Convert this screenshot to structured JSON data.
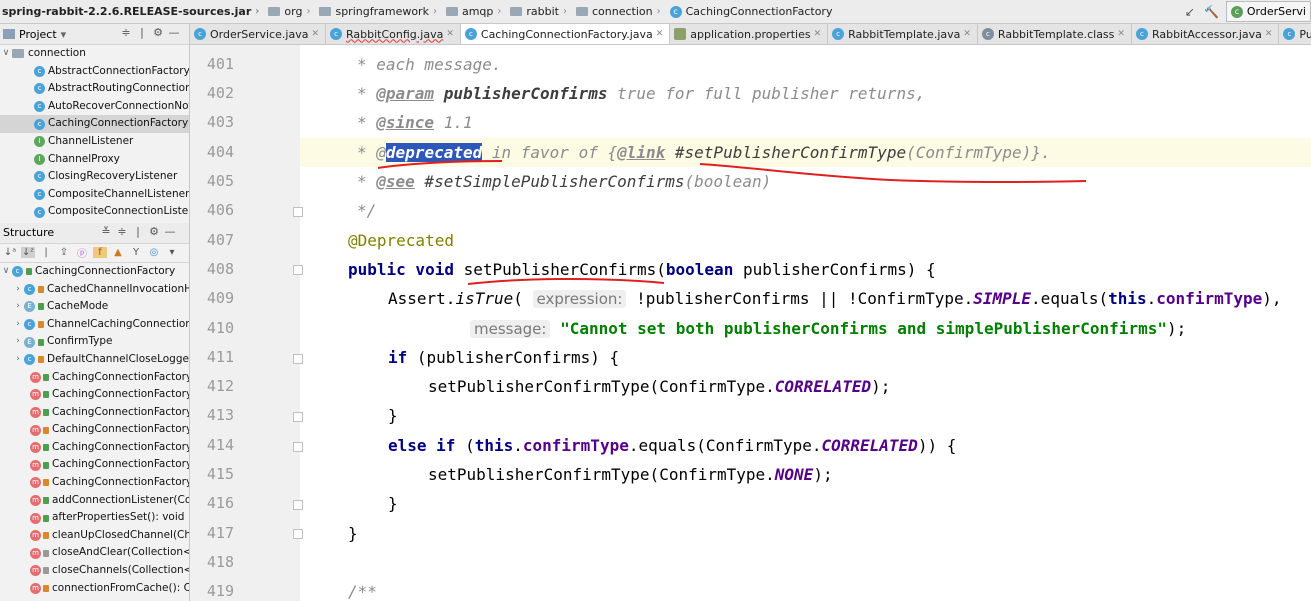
{
  "breadcrumb": {
    "items": [
      {
        "label": "spring-rabbit-2.2.6.RELEASE-sources.jar",
        "icon": "jar-icon"
      },
      {
        "label": "org",
        "icon": "folder-icon"
      },
      {
        "label": "springframework",
        "icon": "folder-icon"
      },
      {
        "label": "amqp",
        "icon": "folder-icon"
      },
      {
        "label": "rabbit",
        "icon": "folder-icon"
      },
      {
        "label": "connection",
        "icon": "folder-icon"
      },
      {
        "label": "CachingConnectionFactory",
        "icon": "class-icon"
      }
    ],
    "run_config": "OrderServi"
  },
  "project_panel": {
    "title": "Project",
    "folder": "connection",
    "items": [
      "AbstractConnectionFactory",
      "AbstractRoutingConnectionFa",
      "AutoRecoverConnectionNotC",
      "CachingConnectionFactory",
      "ChannelListener",
      "ChannelProxy",
      "ClosingRecoveryListener",
      "CompositeChannelListener",
      "CompositeConnectionListene"
    ],
    "selected_index": 3
  },
  "structure_panel": {
    "title": "Structure",
    "root": "CachingConnectionFactory",
    "nested": [
      {
        "label": "CachedChannelInvocationH",
        "kind": "class"
      },
      {
        "label": "CacheMode",
        "kind": "enum"
      },
      {
        "label": "ChannelCachingConnection",
        "kind": "class"
      },
      {
        "label": "ConfirmType",
        "kind": "enum"
      },
      {
        "label": "DefaultChannelCloseLogge",
        "kind": "class"
      }
    ],
    "members": [
      "CachingConnectionFactory(",
      "CachingConnectionFactory(",
      "CachingConnectionFactory(",
      "CachingConnectionFactory(",
      "CachingConnectionFactory(",
      "CachingConnectionFactory(",
      "CachingConnectionFactory(",
      "addConnectionListener(Co",
      "afterPropertiesSet(): void",
      "cleanUpClosedChannel(Cha",
      "closeAndClear(Collection<C",
      "closeChannels(Collection<C",
      "connectionFromCache(): Co"
    ]
  },
  "tabs": [
    {
      "label": "OrderService.java",
      "icon": "class",
      "active": false,
      "wavy": false
    },
    {
      "label": "RabbitConfig.java",
      "icon": "class",
      "active": false,
      "wavy": true
    },
    {
      "label": "CachingConnectionFactory.java",
      "icon": "class",
      "active": true,
      "wavy": false
    },
    {
      "label": "application.properties",
      "icon": "prop",
      "active": false,
      "wavy": false
    },
    {
      "label": "RabbitTemplate.java",
      "icon": "class",
      "active": false,
      "wavy": false
    },
    {
      "label": "RabbitTemplate.class",
      "icon": "cf",
      "active": false,
      "wavy": false
    },
    {
      "label": "RabbitAccessor.java",
      "icon": "class",
      "active": false,
      "wavy": false
    },
    {
      "label": "PublisherCallbackC",
      "icon": "class",
      "active": false,
      "wavy": false
    }
  ],
  "editor": {
    "line_numbers": [
      "401",
      "402",
      "403",
      "404",
      "405",
      "406",
      "407",
      "408",
      "409",
      "410",
      "411",
      "412",
      "413",
      "414",
      "415",
      "416",
      "417",
      "418",
      "419"
    ],
    "code": {
      "l401": "* each message.",
      "l402_star": "* ",
      "l402_tag": "@param",
      "l402_name": " publisherConfirms",
      "l402_rest": " true for full publisher returns,",
      "l403_star": "* ",
      "l403_tag": "@since",
      "l403_rest": " 1.1",
      "l404_star": "* @",
      "l404_sel": "deprecated",
      "l404_mid": " in favor of {",
      "l404_link": "@link",
      "l404_ref": " #setPublisherConfirmType",
      "l404_args": "(ConfirmType)",
      "l404_end": "}.",
      "l405_star": "* ",
      "l405_tag": "@see",
      "l405_ref": " #setSimplePublisherConfirms",
      "l405_args": "(boolean)",
      "l406": "*/",
      "l407": "@Deprecated",
      "l408_kw": "public void ",
      "l408_name": "setPublisherConfirms",
      "l408_p1": "(",
      "l408_kw2": "boolean",
      "l408_p2": " publisherConfirms) {",
      "l409_a": "Assert.",
      "l409_is": "isTrue",
      "l409_paren": "( ",
      "l409_hint": "expression:",
      "l409_b": " !publisherConfirms || !ConfirmType.",
      "l409_simple": "SIMPLE",
      "l409_c": ".equals(",
      "l409_this": "this",
      "l409_dot": ".",
      "l409_field": "confirmType",
      "l409_end": "),",
      "l410_hint": "message:",
      "l410_str": " \"Cannot set both publisherConfirms and simplePublisherConfirms\"",
      "l410_end": ");",
      "l411_kw": "if",
      "l411_rest": " (publisherConfirms) {",
      "l412_a": "setPublisherConfirmType(ConfirmType.",
      "l412_c": "CORRELATED",
      "l412_end": ");",
      "l413": "}",
      "l414_kw": "else if",
      "l414_a": " (",
      "l414_this": "this",
      "l414_dot": ".",
      "l414_field": "confirmType",
      "l414_b": ".equals(ConfirmType.",
      "l414_c": "CORRELATED",
      "l414_end": ")) {",
      "l415_a": "setPublisherConfirmType(ConfirmType.",
      "l415_c": "NONE",
      "l415_end": ");",
      "l416": "}",
      "l417": "}",
      "l419": "/**"
    }
  },
  "colors": {
    "annotation_underline": "#e02020",
    "selection": "#2d57b9",
    "current_line": "#fdfbe3"
  }
}
